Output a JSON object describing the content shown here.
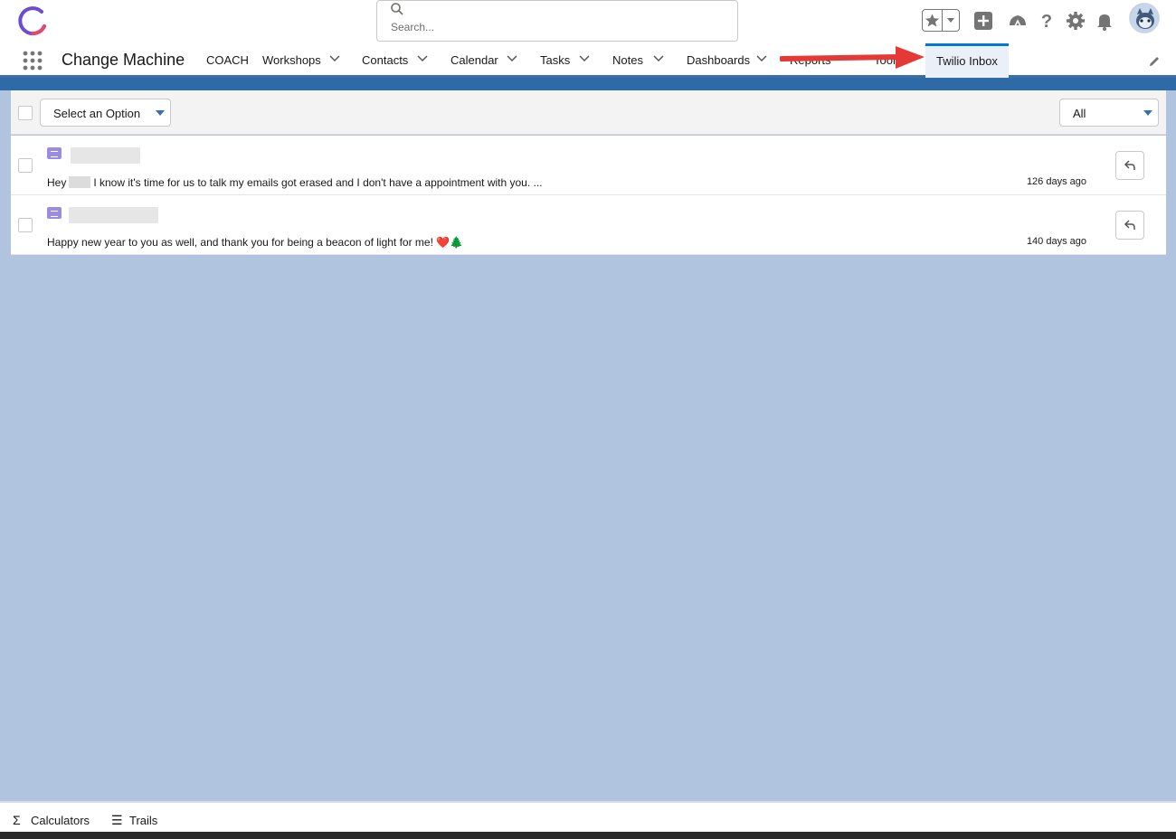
{
  "header": {
    "search_placeholder": "Search...",
    "icons": [
      "app-logo-icon",
      "search-icon",
      "favorites-star-icon",
      "chevron-down-icon",
      "global-add-icon",
      "trailhead-icon",
      "help-icon",
      "setup-gear-icon",
      "notifications-bell-icon",
      "user-avatar"
    ]
  },
  "nav": {
    "app_name": "Change Machine",
    "items": [
      {
        "label": "COACH"
      },
      {
        "label": "Workshops"
      },
      {
        "label": "Contacts"
      },
      {
        "label": "Calendar"
      },
      {
        "label": "Tasks"
      },
      {
        "label": "Notes"
      },
      {
        "label": "Dashboards"
      },
      {
        "label": "Reports"
      },
      {
        "label": "Tools"
      }
    ],
    "active_tab": "Twilio Inbox"
  },
  "toolbar": {
    "action_select": "Select an Option",
    "filter_select": "All"
  },
  "messages": [
    {
      "prefix": "Hey",
      "text": "I know it's time for us to talk my emails got erased and I don't have a appointment with you. ...",
      "time": "126 days ago"
    },
    {
      "text": "Happy new year to you as well, and thank you for being a beacon of light for me! ❤️🌲",
      "time": "140 days ago"
    }
  ],
  "utility_bar": {
    "items": [
      {
        "label": "Calculators",
        "icon": "sigma-icon"
      },
      {
        "label": "Trails",
        "icon": "list-icon"
      }
    ]
  },
  "colors": {
    "brand_blue": "#0176d3",
    "page_background": "#b0c4df",
    "annotation_arrow": "#e53935"
  }
}
